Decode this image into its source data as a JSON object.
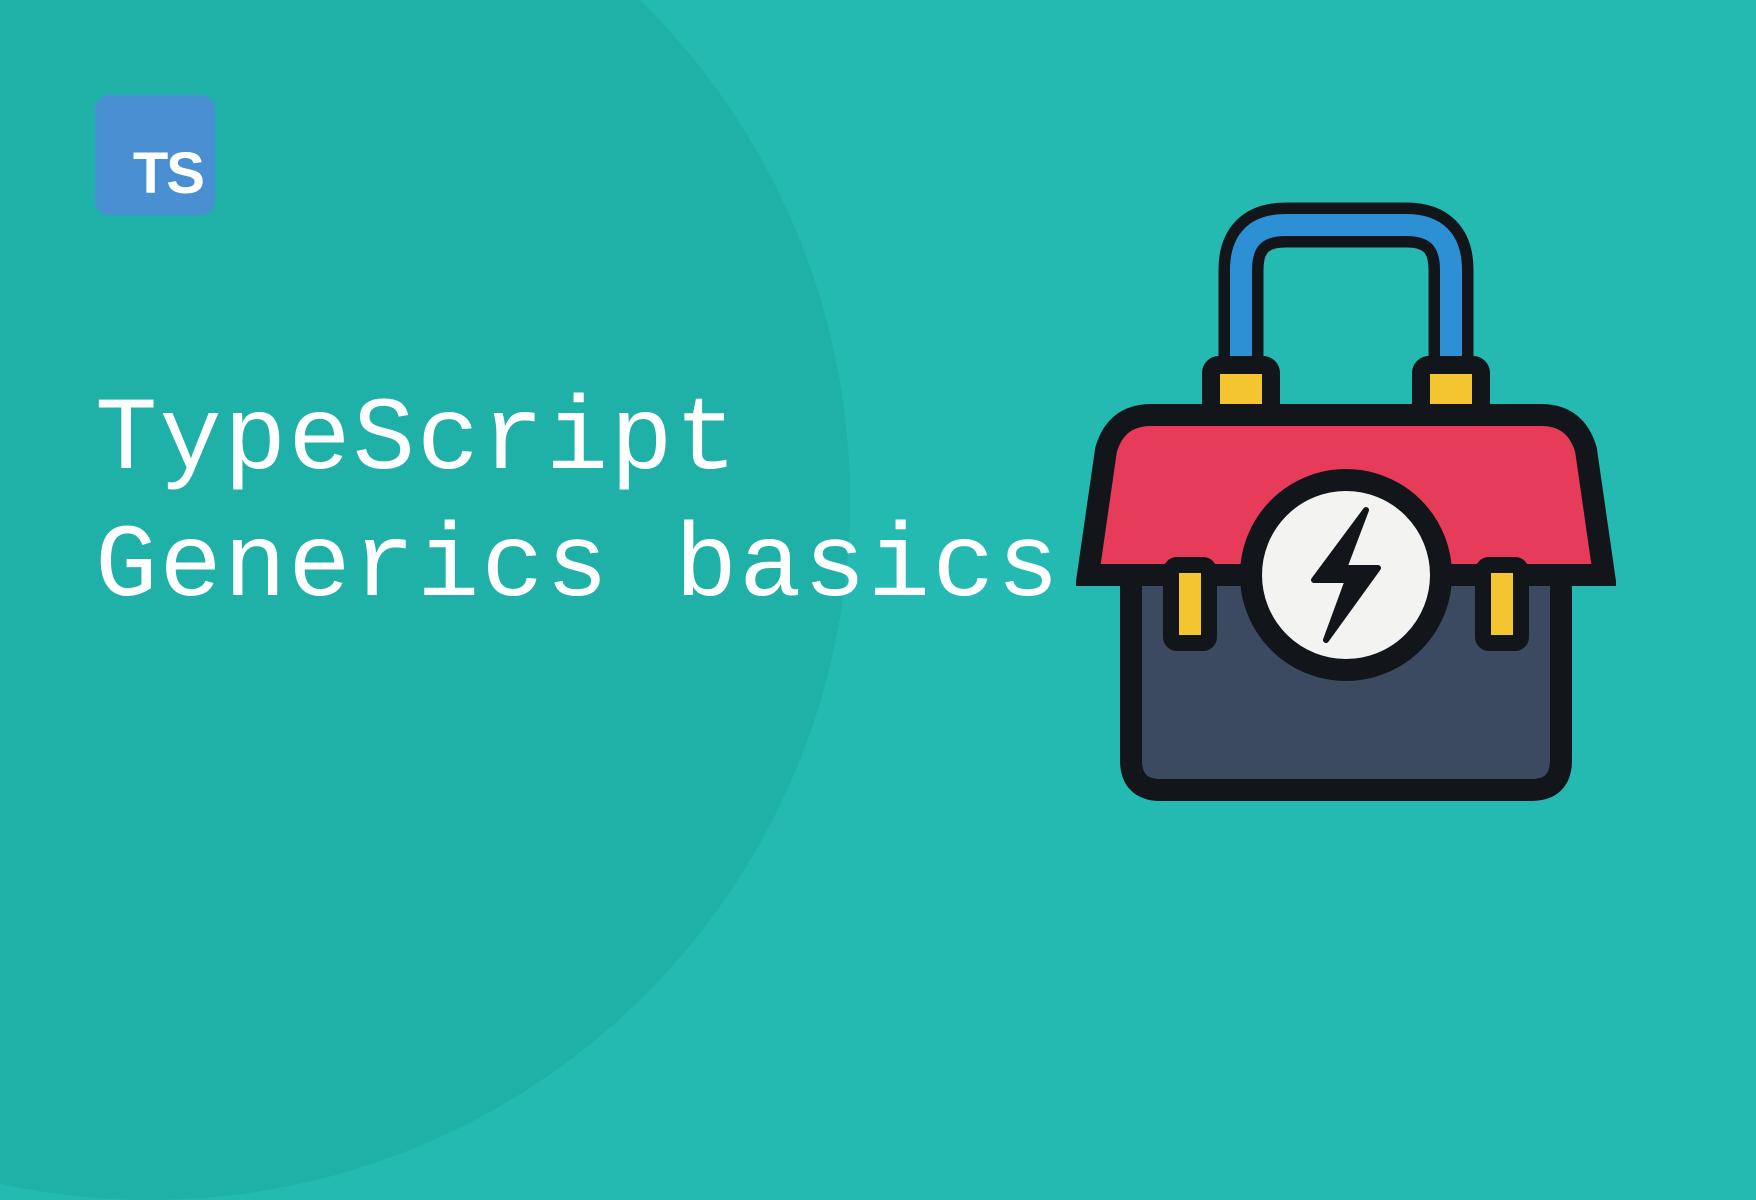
{
  "logo": {
    "text": "TS"
  },
  "title": {
    "line1": "TypeScript",
    "line2": "Generics basics"
  },
  "colors": {
    "background": "#24bab1",
    "logoBackground": "#4a8fd1",
    "textColor": "#ffffff",
    "toolboxRed": "#e63c5a",
    "toolboxBlue": "#3b4a61",
    "toolboxYellow": "#f5c530",
    "toolboxHandle": "#2d8fd4",
    "toolboxOutline": "#12151a"
  },
  "icons": {
    "logo": "typescript-logo",
    "illustration": "toolbox-lightning"
  }
}
